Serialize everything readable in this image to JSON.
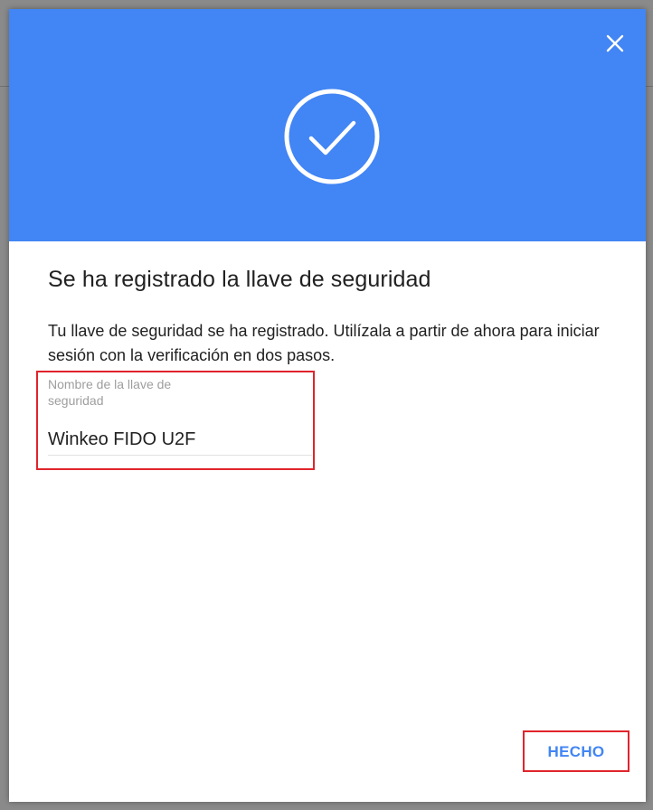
{
  "dialog": {
    "title": "Se ha registrado la llave de seguridad",
    "description": "Tu llave de seguridad se ha registrado. Utilízala a partir de ahora para iniciar sesión con la verificación en dos pasos.",
    "field": {
      "label": "Nombre de la llave de seguridad",
      "value": "Winkeo FIDO U2F"
    },
    "done_label": "HECHO",
    "close_icon": "close-icon",
    "success_icon": "check-circle-icon"
  },
  "colors": {
    "header": "#4285f4",
    "accent": "#4285f4",
    "highlight": "#e0242c"
  }
}
